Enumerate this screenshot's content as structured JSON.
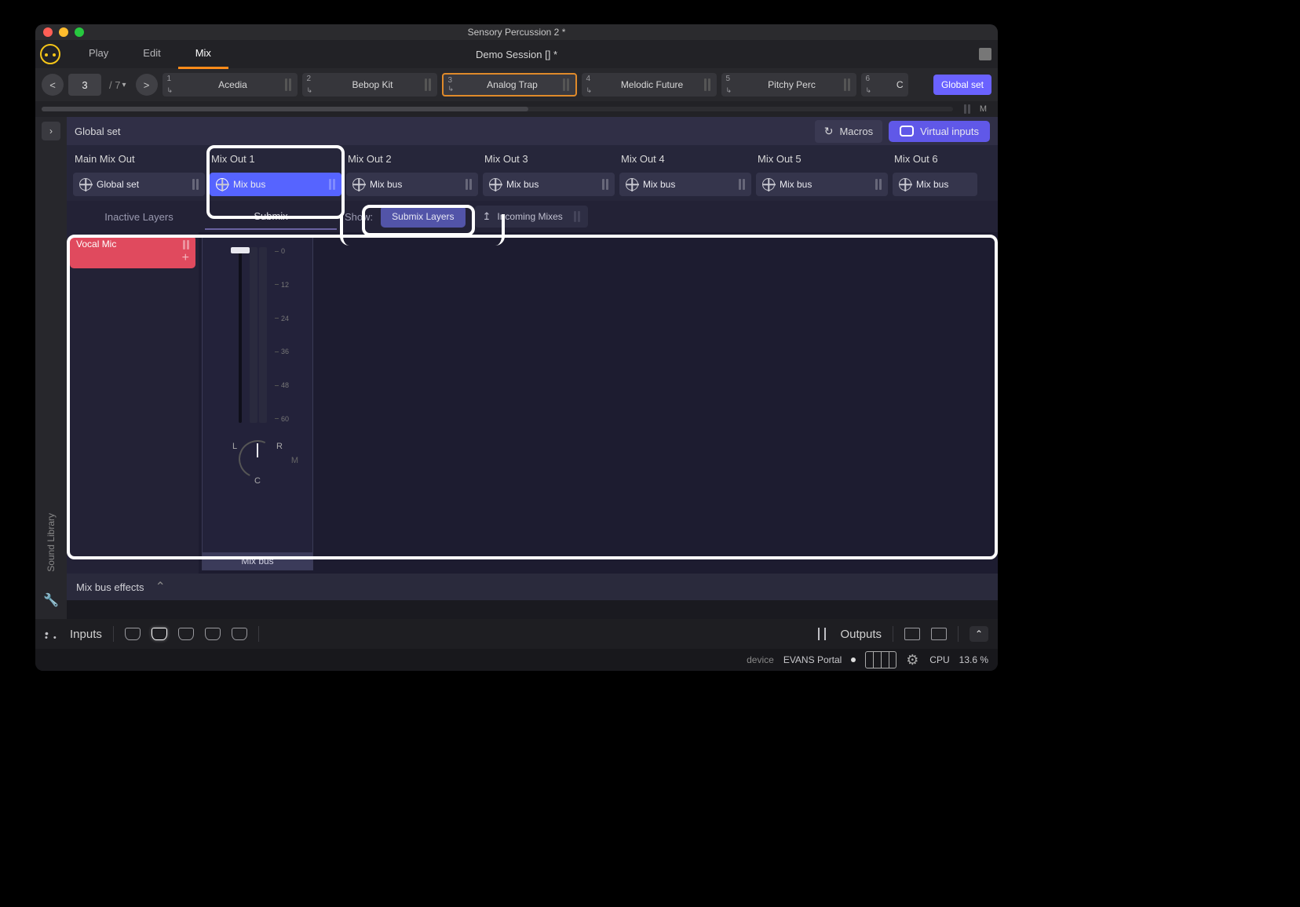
{
  "window": {
    "title": "Sensory Percussion 2 *"
  },
  "header": {
    "tabs": [
      "Play",
      "Edit",
      "Mix"
    ],
    "active_tab": "Mix",
    "session": "Demo Session  [] *"
  },
  "kitbar": {
    "page_current": "3",
    "page_total": "/ 7",
    "prev": "<",
    "next": ">",
    "kits": [
      {
        "num": "1",
        "name": "Acedia"
      },
      {
        "num": "2",
        "name": "Bebop Kit"
      },
      {
        "num": "3",
        "name": "Analog Trap",
        "selected": true
      },
      {
        "num": "4",
        "name": "Melodic Future"
      },
      {
        "num": "5",
        "name": "Pitchy Perc"
      },
      {
        "num": "6",
        "name": "C"
      }
    ],
    "global_set_btn": "Global set",
    "m_label": "M"
  },
  "global_row": {
    "label": "Global set",
    "macros": "Macros",
    "virtual_inputs": "Virtual inputs"
  },
  "mixouts": [
    {
      "title": "Main Mix Out",
      "bus": "Global set"
    },
    {
      "title": "Mix Out 1",
      "bus": "Mix bus",
      "selected": true
    },
    {
      "title": "Mix Out 2",
      "bus": "Mix bus"
    },
    {
      "title": "Mix Out 3",
      "bus": "Mix bus"
    },
    {
      "title": "Mix Out 4",
      "bus": "Mix bus"
    },
    {
      "title": "Mix Out 5",
      "bus": "Mix bus"
    },
    {
      "title": "Mix Out 6",
      "bus": "Mix bus"
    }
  ],
  "subtabs": {
    "inactive": "Inactive Layers",
    "submix": "Submix",
    "show": "Show:",
    "submix_layers": "Submix Layers",
    "incoming": "Incoming Mixes"
  },
  "vocal": {
    "label": "Vocal Mic"
  },
  "fader": {
    "scale": [
      "0",
      "12",
      "24",
      "36",
      "48",
      "60"
    ],
    "L": "L",
    "R": "R",
    "C": "C",
    "M": "M",
    "label": "Mix bus"
  },
  "fx": {
    "label": "Mix bus effects"
  },
  "leftrail": {
    "label": "Sound Library"
  },
  "iobar": {
    "inputs": "Inputs",
    "outputs": "Outputs"
  },
  "status": {
    "device_label": "device",
    "device_name": "EVANS Portal",
    "cpu_label": "CPU",
    "cpu_value": "13.6 %"
  }
}
